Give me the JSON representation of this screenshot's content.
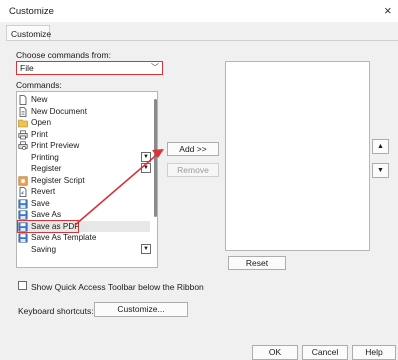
{
  "window": {
    "title": "Customize",
    "close_glyph": "×"
  },
  "tabs": [
    {
      "label": "Customize"
    }
  ],
  "choose": {
    "label": "Choose commands from:",
    "selected": "File",
    "chevron": "﹀"
  },
  "commands": {
    "label": "Commands:",
    "items": [
      {
        "label": "New",
        "icon": "new-doc-icon"
      },
      {
        "label": "New Document",
        "icon": "new-document-icon"
      },
      {
        "label": "Open",
        "icon": "folder-icon"
      },
      {
        "label": "Print",
        "icon": "printer-icon"
      },
      {
        "label": "Print Preview",
        "icon": "print-preview-icon"
      },
      {
        "label": "Printing",
        "icon": ""
      },
      {
        "label": "Register",
        "icon": ""
      },
      {
        "label": "Register Script",
        "icon": "script-icon"
      },
      {
        "label": "Revert",
        "icon": "revert-icon"
      },
      {
        "label": "Save",
        "icon": "save-icon"
      },
      {
        "label": "Save As",
        "icon": "save-as-icon"
      },
      {
        "label": "Save as PDF",
        "icon": "pdf-icon"
      },
      {
        "label": "Save As Template",
        "icon": "template-icon"
      },
      {
        "label": "Saving",
        "icon": ""
      }
    ]
  },
  "buttons": {
    "add": "Add >>",
    "remove": "Remove",
    "reset": "Reset",
    "up": "▲",
    "down": "▼",
    "customize": "Customize...",
    "ok": "OK",
    "cancel": "Cancel",
    "help": "Help"
  },
  "show_qat": {
    "label": "Show Quick Access Toolbar below the Ribbon",
    "checked": false
  },
  "keyboard": {
    "label": "Keyboard shortcuts:"
  },
  "colors": {
    "highlight": "#d9333a"
  }
}
